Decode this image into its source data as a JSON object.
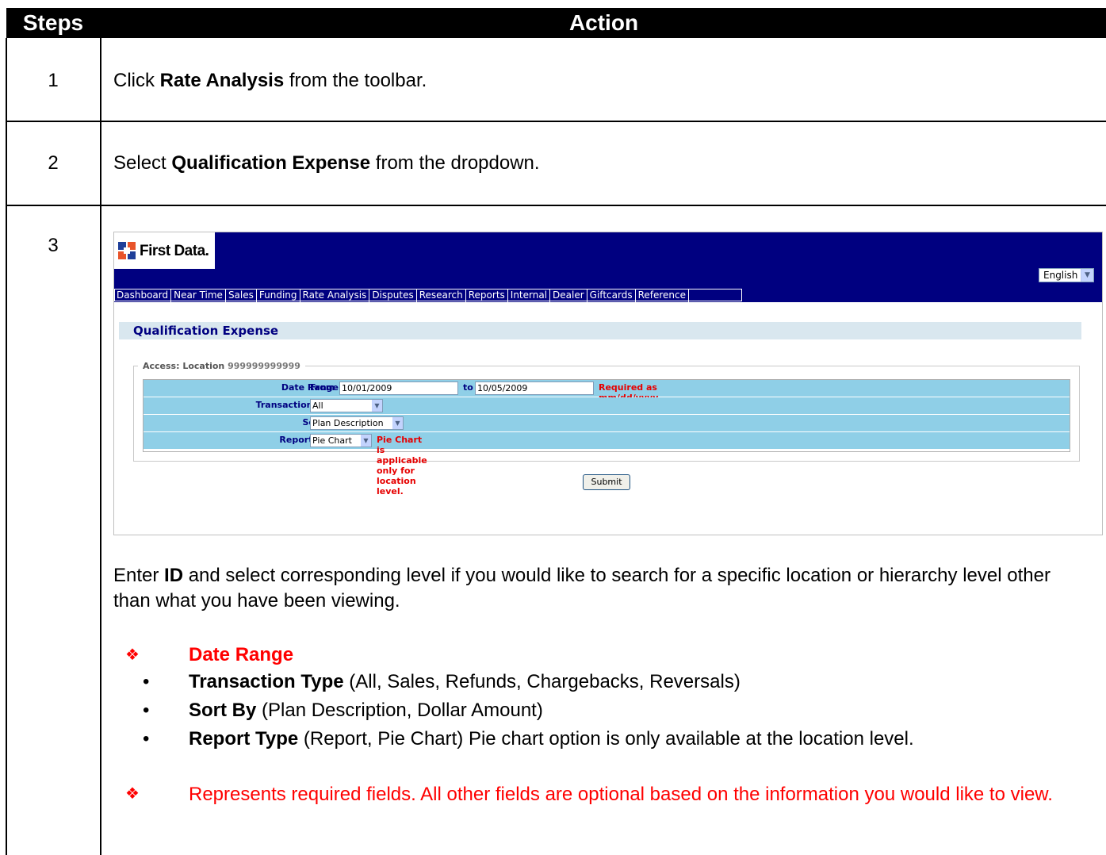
{
  "header": {
    "steps": "Steps",
    "action": "Action"
  },
  "steps": [
    {
      "number": "1",
      "pre": "Click ",
      "bold": "Rate Analysis",
      "post": " from the toolbar."
    },
    {
      "number": "2",
      "pre": "Select ",
      "bold": "Qualification Expense",
      "post": " from the dropdown."
    },
    {
      "number": "3"
    }
  ],
  "app": {
    "logo_text": "First Data.",
    "language": "English",
    "nav": [
      "Dashboard",
      "Near Time",
      "Sales",
      "Funding",
      "Rate Analysis",
      "Disputes",
      "Research",
      "Reports",
      "Internal",
      "Dealer",
      "Giftcards",
      "Reference"
    ],
    "page_title": "Qualification Expense",
    "legend_label": "Access: Location",
    "legend_value": "999999999999",
    "form": {
      "date_range_label": "Date Range",
      "from_label": "From",
      "from_value": "10/01/2009",
      "to_label": "to",
      "to_value": "10/05/2009",
      "date_hint": "Required as mm/dd/yyyy",
      "transaction_type_label": "Transaction Type",
      "transaction_type_value": "All",
      "sort_by_label": "Sort By",
      "sort_by_value": "Plan Description",
      "report_type_label": "Report Type",
      "report_type_value": "Pie Chart",
      "report_hint": "Pie Chart is applicable only for location level."
    },
    "submit_label": "Submit"
  },
  "description": {
    "p1_pre": "Enter ",
    "p1_bold": "ID",
    "p1_post": " and select corresponding level if you would like to search for a specific location or hierarchy level other than what you have been viewing."
  },
  "fields": [
    {
      "bold": "Date Range",
      "text": "",
      "required": true
    },
    {
      "bold": "Transaction Type",
      "text": " (All, Sales, Refunds, Chargebacks, Reversals)",
      "required": false
    },
    {
      "bold": "Sort By",
      "text": " (Plan Description, Dollar Amount)",
      "required": false
    },
    {
      "bold": "Report Type",
      "text": " (Report, Pie Chart) Pie chart option is only available at the location level.",
      "required": false
    }
  ],
  "note": "Represents required fields. All other fields are optional based on the information you would like to view.",
  "colors": {
    "header_bg": "#000000",
    "app_bar": "#000080",
    "form_row": "#8fcfe7",
    "required": "#ff0000"
  }
}
